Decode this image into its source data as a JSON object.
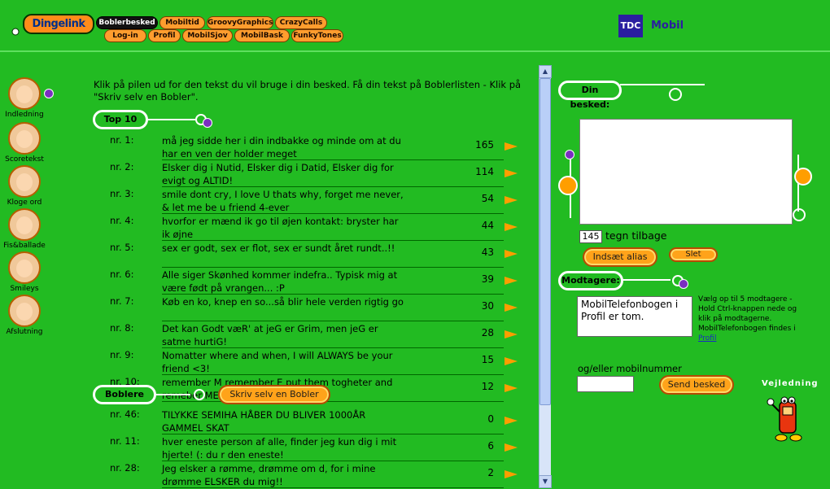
{
  "header": {
    "logo": "Dingelink",
    "nav_row1": [
      "Boblerbesked",
      "Mobiltid",
      "GroovyGraphics",
      "CrazyCalls"
    ],
    "nav_row2": [
      "Log-in",
      "Profil",
      "MobilSjov",
      "MobilBask",
      "FunkyTones"
    ],
    "tdc_logo": "TDC",
    "tdc_label": "Mobil"
  },
  "sidebar": {
    "items": [
      {
        "label": "Indledning"
      },
      {
        "label": "Scoretekst"
      },
      {
        "label": "Kloge ord"
      },
      {
        "label": "Fis&ballade"
      },
      {
        "label": "Smileys"
      },
      {
        "label": "Afslutning"
      }
    ]
  },
  "main": {
    "intro": "Klik på pilen ud for den tekst du vil bruge i din besked. Få din tekst på Boblerlisten - Klik på \"Skriv selv en Bobler\".",
    "top10_label": "Top 10",
    "top10": [
      {
        "no": "nr. 1:",
        "text": "må jeg sidde her i din indbakke og minde om at du har en ven der holder meget",
        "count": "165"
      },
      {
        "no": "nr. 2:",
        "text": "Elsker dig i Nutid, Elsker dig i Datid, Elsker dig for evigt og ALTID!",
        "count": "114"
      },
      {
        "no": "nr. 3:",
        "text": "smile dont cry, I love U thats why, forget me never, & let me be u friend 4-ever",
        "count": "54"
      },
      {
        "no": "nr. 4:",
        "text": "hvorfor er mænd ik go til øjen kontakt: bryster har ik øjne",
        "count": "44"
      },
      {
        "no": "nr. 5:",
        "text": "sex er godt, sex er flot, sex er sundt året rundt..!!",
        "count": "43"
      },
      {
        "no": "nr. 6:",
        "text": "Alle siger Skønhed kommer indefra.. Typisk mig at være født på vrangen... :P",
        "count": "39"
      },
      {
        "no": "nr. 7:",
        "text": "Køb en ko, knep en so...så blir hele verden rigtig go",
        "count": "30"
      },
      {
        "no": "nr. 8:",
        "text": "Det kan Godt væR' at jeG er Grim, men jeG er satme hurtiG!",
        "count": "28"
      },
      {
        "no": "nr. 9:",
        "text": "Nomatter where and when, I will ALWAYS be your friend <3!",
        "count": "15"
      },
      {
        "no": "nr. 10:",
        "text": "remember M remember E put them togheter and remeber ME!!",
        "count": "12"
      }
    ],
    "boblere_label": "Boblere",
    "write_button": "Skriv selv en Bobler",
    "boblere": [
      {
        "no": "nr. 46:",
        "text": "TILYKKE SEMIHA HÅBER DU BLIVER 1000ÅR GAMMEL SKAT",
        "count": "0"
      },
      {
        "no": "nr. 11:",
        "text": "hver eneste person af alle, finder jeg kun dig i mit hjerte! (: du r den eneste!",
        "count": "6"
      },
      {
        "no": "nr. 28:",
        "text": "Jeg elsker a rømme, drømme om d, for i mine drømme ELSKER du mig!!",
        "count": "2"
      }
    ]
  },
  "right": {
    "din_besked_label": "Din besked:",
    "message_value": "",
    "chars_left": "145",
    "chars_left_label": "tegn tilbage",
    "alias_button": "Indsæt alias",
    "delete_button": "Slet",
    "modtagere_label": "Modtagere:",
    "recipients_text": "MobilTelefonbogen i Profil er tom.",
    "help_text": "Vælg op til 5 modtagere - Hold Ctrl-knappen nede og klik på modtagerne. MobilTelefonbogen findes i",
    "help_link": "Profil",
    "mobile_label": "og/eller mobilnummer",
    "mobile_value": "",
    "send_button": "Send besked",
    "mascot_text": "Vejledning"
  },
  "colors": {
    "background": "#22bb22",
    "orange": "#ff9e00",
    "tdc_blue": "#2a1fa0",
    "purple": "#7a2fc0"
  }
}
